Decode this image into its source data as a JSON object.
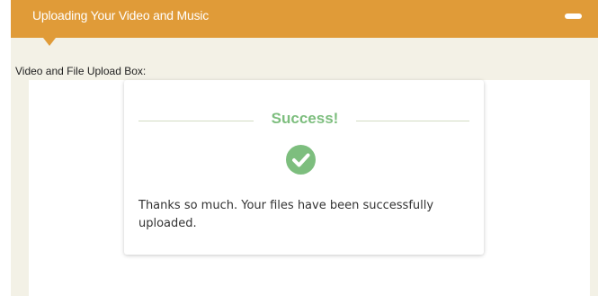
{
  "header": {
    "title": "Uploading Your Video and Music",
    "collapse_icon": "minus-icon",
    "color": "#e09b38"
  },
  "section": {
    "label": "Video and File Upload Box:"
  },
  "success": {
    "title": "Success!",
    "icon": "check-circle-icon",
    "accent_color": "#7dbe7e",
    "message": "Thanks so much. Your files have been successfully uploaded."
  }
}
